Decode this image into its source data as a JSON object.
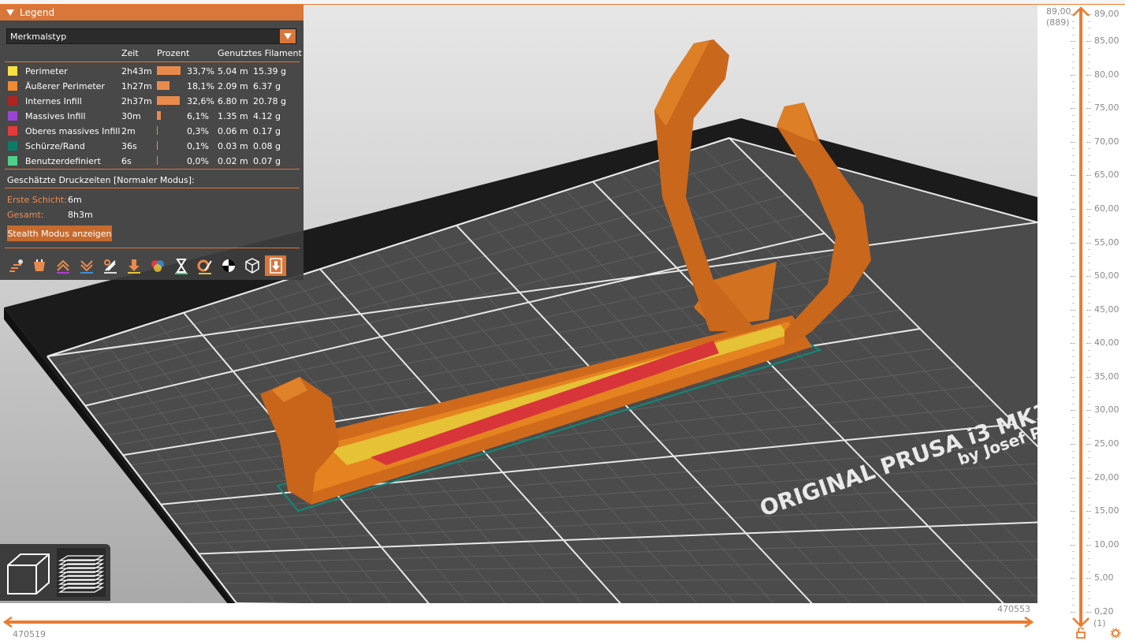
{
  "legend": {
    "title": "Legend",
    "view_type": "Merkmalstyp",
    "columns": {
      "time": "Zeit",
      "percent": "Prozent",
      "filament": "Genutztes Filament"
    },
    "rows": [
      {
        "color": "#f5e142",
        "name": "Perimeter",
        "time": "2h43m",
        "percent": "33,7%",
        "percent_value": 33.7,
        "length": "5.04 m",
        "weight": "15.39 g"
      },
      {
        "color": "#f08a33",
        "name": "Äußerer Perimeter",
        "time": "1h27m",
        "percent": "18,1%",
        "percent_value": 18.1,
        "length": "2.09 m",
        "weight": "6.37 g"
      },
      {
        "color": "#b02323",
        "name": "Internes Infill",
        "time": "2h37m",
        "percent": "32,6%",
        "percent_value": 32.6,
        "length": "6.80 m",
        "weight": "20.78 g"
      },
      {
        "color": "#9b45d6",
        "name": "Massives Infill",
        "time": "30m",
        "percent": "6,1%",
        "percent_value": 6.1,
        "length": "1.35 m",
        "weight": "4.12 g"
      },
      {
        "color": "#e63a3a",
        "name": "Oberes massives Infill",
        "time": "2m",
        "percent": "0,3%",
        "percent_value": 0.3,
        "length": "0.06 m",
        "weight": "0.17 g"
      },
      {
        "color": "#0a7d6a",
        "name": "Schürze/Rand",
        "time": "36s",
        "percent": "0,1%",
        "percent_value": 0.1,
        "length": "0.03 m",
        "weight": "0.08 g"
      },
      {
        "color": "#4fcf8a",
        "name": "Benutzerdefiniert",
        "time": "6s",
        "percent": "0,0%",
        "percent_value": 0.0,
        "length": "0.02 m",
        "weight": "0.07 g"
      }
    ],
    "estimated_title": "Geschätzte Druckzeiten [Normaler Modus]:",
    "first_layer_label": "Erste Schicht:",
    "first_layer_value": "6m",
    "total_label": "Gesamt:",
    "total_value": "8h3m",
    "stealth_button": "Stealth Modus anzeigen",
    "icons": [
      "travel-icon",
      "wipe-icon",
      "retractions-icon",
      "deretractions-icon",
      "seams-icon",
      "tool-changes-icon",
      "color-changes-icon",
      "pause-icon",
      "custom-gcode-icon",
      "center-of-gravity-icon",
      "shells-icon",
      "tool-marker-icon"
    ]
  },
  "bed": {
    "brand_line1": "ORIGINAL PRUSA i3 MK3",
    "brand_line2": "by Josef Prusa"
  },
  "vertical_slider": {
    "top_value": "89,00",
    "top_layer": "(889)",
    "bottom_value": "0,20",
    "bottom_layer": "(1)",
    "ticks": [
      "89,00",
      "85,00",
      "80,00",
      "75,00",
      "70,00",
      "65,00",
      "60,00",
      "55,00",
      "50,00",
      "45,00",
      "40,00",
      "35,00",
      "30,00",
      "25,00",
      "20,00",
      "15,00",
      "10,00",
      "5,00",
      "0,20"
    ]
  },
  "horizontal_slider": {
    "left_value": "470519",
    "right_value": "470553"
  },
  "accent_color": "#ec7b2f"
}
